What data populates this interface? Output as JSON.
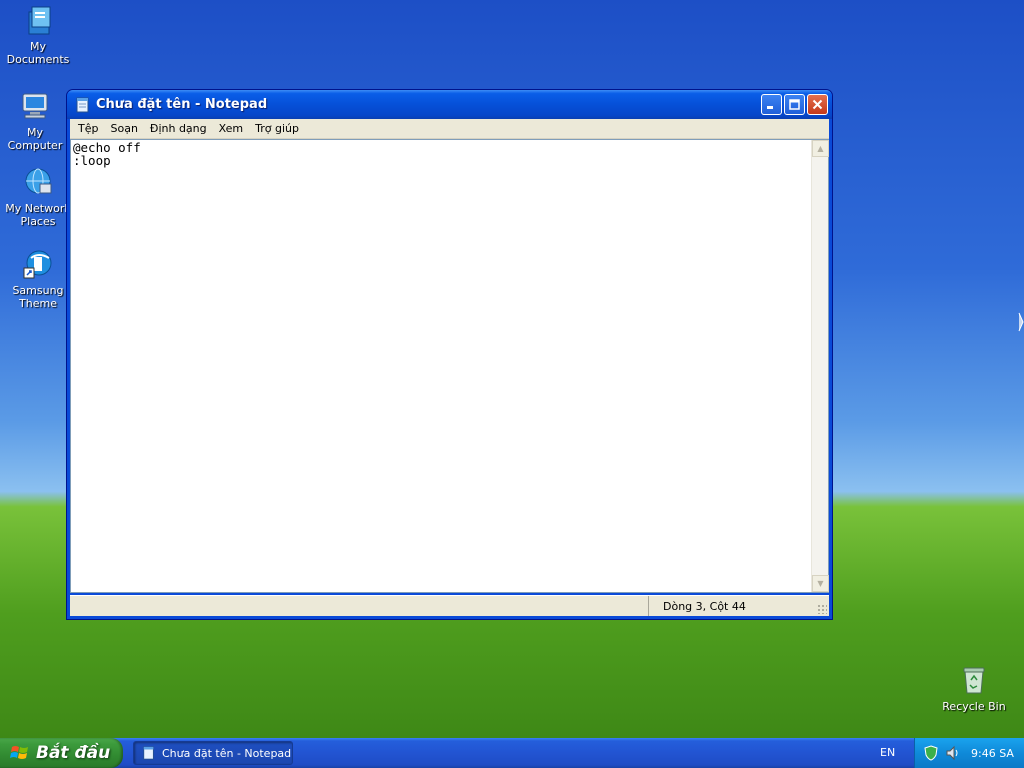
{
  "desktop": {
    "icons": [
      {
        "label": "My Documents"
      },
      {
        "label": "My Computer"
      },
      {
        "label": "My Network Places"
      },
      {
        "label": "Samsung Theme"
      },
      {
        "label": "Recycle Bin"
      }
    ]
  },
  "window": {
    "title": "Chưa đặt tên - Notepad",
    "menu": [
      "Tệp",
      "Soạn",
      "Định dạng",
      "Xem",
      "Trợ giúp"
    ],
    "content": "@echo off\n:loop",
    "status_position": "Dòng 3, Cột 44"
  },
  "taskbar": {
    "start_label": "Bắt đầu",
    "task_label": "Chưa đặt tên - Notepad",
    "language": "EN",
    "clock": "9:46 SA"
  },
  "colors": {
    "titlebar": "#0650d8",
    "taskbar": "#245edb",
    "start": "#3c9b3c",
    "tray": "#0f8ad9"
  }
}
